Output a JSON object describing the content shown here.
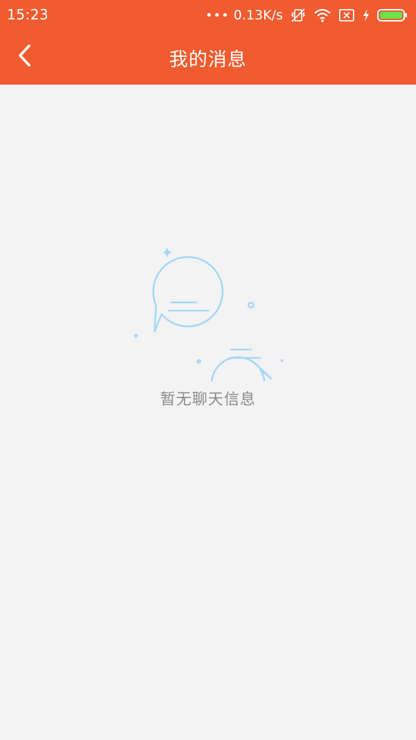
{
  "status_bar": {
    "time": "15:23",
    "dots": "•••",
    "network_speed": "0.13K/s",
    "icons": [
      "vibrate-off-icon",
      "wifi-icon",
      "no-sim-icon",
      "charging-icon",
      "battery-icon"
    ]
  },
  "header": {
    "title": "我的消息",
    "back_icon": "chevron-left-icon",
    "background_color": "#f05b30"
  },
  "empty_state": {
    "illustration": "chat-bubbles-icon",
    "message": "暂无聊天信息",
    "accent_color": "#a6d8f7"
  }
}
